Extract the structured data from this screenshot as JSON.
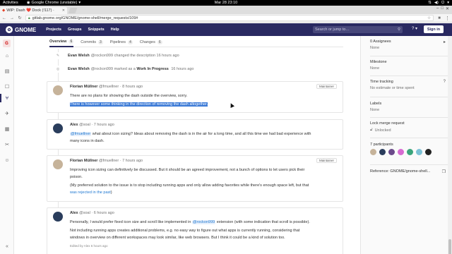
{
  "system_bar": {
    "activities": "Activities",
    "app_name": "Google Chrome (unstable)",
    "clock": "Mar 28  23:10"
  },
  "browser": {
    "tab_title": "WIP: Dash ❤️ Dock (!117) ·",
    "url": "gitlab.gnome.org/GNOME/gnome-shell/merge_requests/109#"
  },
  "header": {
    "logo_text": "GNOME",
    "nav": [
      "Projects",
      "Groups",
      "Snippets",
      "Help"
    ],
    "search_placeholder": "Search or jump to…",
    "signin_label": "Sign in",
    "brand_color": "#292961"
  },
  "project_avatar": "G",
  "tabs": [
    {
      "label": "Overview",
      "count": "6"
    },
    {
      "label": "Commits",
      "count": "3"
    },
    {
      "label": "Pipelines",
      "count": "4"
    },
    {
      "label": "Changes",
      "count": "6"
    }
  ],
  "system_notes": [
    {
      "author": "Evan Welsh",
      "handle": "@rockon999",
      "action": "changed the description",
      "time": "16 hours ago"
    },
    {
      "author": "Evan Welsh",
      "handle": "@rockon999",
      "action": "marked as a",
      "highlight": "Work In Progress",
      "time": "16 hours ago"
    }
  ],
  "comments": [
    {
      "author": "Florian Müllner",
      "handle": "@fmuellner",
      "time": "8 hours ago",
      "badge": "Maintainer",
      "line1": "There are no plans for showing the dash outside the overview, sorry.",
      "line2": "There is however some thinking in the direction of removing the dash altogether."
    },
    {
      "author": "Alex",
      "handle": "@soal",
      "time": "7 hours ago",
      "mention": "@fmuellner",
      "line1_rest": " what about icon sizing? Ideas about removing the dash is in the air for a long time, and all this time we had bad experience with",
      "line2": "many icons in dash."
    },
    {
      "author": "Florian Müllner",
      "handle": "@fmuellner",
      "time": "7 hours ago",
      "badge": "Maintainer",
      "line1": "Improving icon sizing can definitively be discussed. But it should be an agreed improvement, not a bunch of options to let users pick their",
      "line2": "poison.",
      "line3": "(My preferred solution to the issue is to stop including running apps and only allow adding favorites while there's enough space left, but that",
      "line4_link": "was rejected in the past",
      "line4_end": ")"
    },
    {
      "author": "Alex",
      "handle": "@soal",
      "time": "6 hours ago",
      "line1_start": "Personally, I would prefer fixed icon size and scroll like implemented in ",
      "line1_mention": "@rockon999",
      "line1_end": " extension (with some indication that scroll is possible).",
      "line2": "Not including running apps creates additional problems, e.g. no easy way to figure out what apps is currently running, considering that",
      "line3": "windows in overview on different workspaces may look similar, like web browsers. But I think it could be a kind of solution too.",
      "edited": "Edited by Alex 6 hours ago"
    }
  ],
  "sidebar": {
    "assignees_title": "0 Assignees",
    "assignees_value": "None",
    "milestone_title": "Milestone",
    "milestone_value": "None",
    "time_title": "Time tracking",
    "time_value": "No estimate or time spent",
    "labels_title": "Labels",
    "labels_value": "None",
    "lock_title": "Lock merge request",
    "lock_value": "Unlocked",
    "participants_title": "7 participants",
    "reference": "Reference: GNOME/gnome-shell..."
  }
}
